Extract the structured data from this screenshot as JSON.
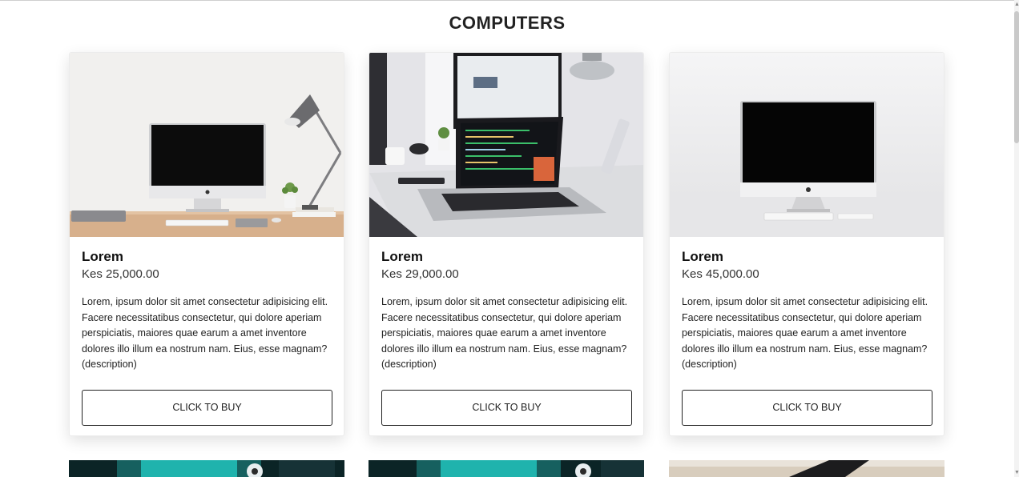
{
  "page": {
    "title": "COMPUTERS"
  },
  "products": [
    {
      "name": "Lorem",
      "price": "Kes 25,000.00",
      "description": "Lorem, ipsum dolor sit amet consectetur adipisicing elit. Facere necessitatibus consectetur, qui dolore aperiam perspiciatis, maiores quae earum a amet inventore dolores illo illum ea nostrum nam. Eius, esse magnam?(description)",
      "button_label": "CLICK TO BUY",
      "image": "imac-desk-lamp-photo"
    },
    {
      "name": "Lorem",
      "price": "Kes 29,000.00",
      "description": "Lorem, ipsum dolor sit amet consectetur adipisicing elit. Facere necessitatibus consectetur, qui dolore aperiam perspiciatis, maiores quae earum a amet inventore dolores illo illum ea nostrum nam. Eius, esse magnam?(description)",
      "button_label": "CLICK TO BUY",
      "image": "laptop-code-desk-photo"
    },
    {
      "name": "Lorem",
      "price": "Kes 45,000.00",
      "description": "Lorem, ipsum dolor sit amet consectetur adipisicing elit. Facere necessitatibus consectetur, qui dolore aperiam perspiciatis, maiores quae earum a amet inventore dolores illo illum ea nostrum nam. Eius, esse magnam?(description)",
      "button_label": "CLICK TO BUY",
      "image": "imac-white-background-photo"
    }
  ],
  "colors": {
    "border": "#222222",
    "card_shadow": "rgba(0,0,0,0.12)",
    "accent_teal": "#1fb3ad"
  }
}
